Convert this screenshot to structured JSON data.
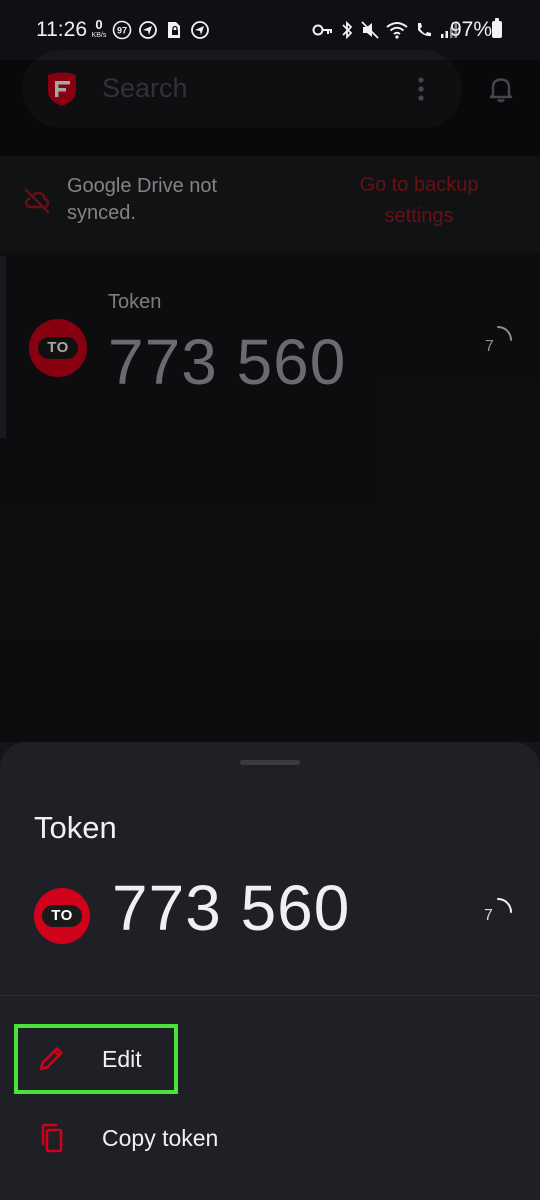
{
  "status_bar": {
    "time": "11:26",
    "net_speed_value": "0",
    "net_speed_unit": "KB/s",
    "badge_count": "97",
    "battery": "97%",
    "left_icons": [
      "badge-97-icon",
      "navigation-icon",
      "sim-lock-icon",
      "navigation-icon"
    ],
    "right_icons": [
      "key-icon",
      "bluetooth-icon",
      "mute-icon",
      "wifi-icon",
      "wifi-calling-icon",
      "signal-icon",
      "battery-icon"
    ]
  },
  "search": {
    "placeholder": "Search",
    "logo": "freeotp-shield-logo",
    "menu_icon": "more-vertical-icon",
    "notification_icon": "bell-icon"
  },
  "sync_banner": {
    "icon": "cloud-off-icon",
    "message": "Google Drive not synced.",
    "action_label": "Go to backup settings"
  },
  "token_list": [
    {
      "name": "Token",
      "avatar_text": "TO",
      "code": "773 560",
      "seconds_left": "7"
    }
  ],
  "bottom_sheet": {
    "title": "Token",
    "avatar_text": "TO",
    "code": "773 560",
    "seconds_left": "7",
    "actions": [
      {
        "label": "Edit",
        "icon": "pencil-icon"
      },
      {
        "label": "Copy token",
        "icon": "copy-icon"
      }
    ]
  },
  "colors": {
    "accent_red": "#d0021b",
    "link_red": "#a11a1f",
    "highlight_green": "#4be33b",
    "background": "#141519",
    "sheet_background": "#1f2025"
  }
}
